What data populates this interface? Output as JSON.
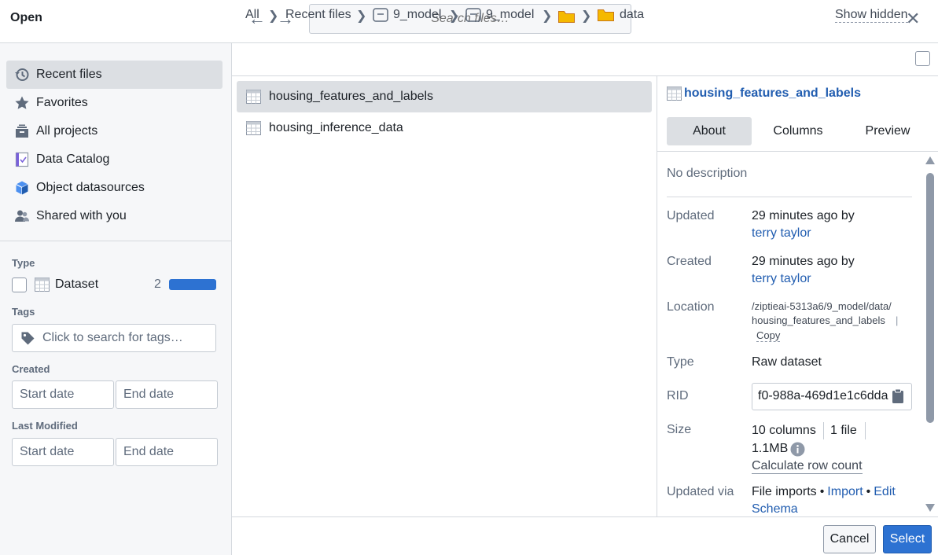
{
  "window": {
    "title": "Open"
  },
  "search": {
    "placeholder": "Search files…"
  },
  "sidebar": {
    "items": [
      {
        "label": "Recent files",
        "icon": "history-icon"
      },
      {
        "label": "Favorites",
        "icon": "star-icon"
      },
      {
        "label": "All projects",
        "icon": "projects-icon"
      },
      {
        "label": "Data Catalog",
        "icon": "catalog-icon"
      },
      {
        "label": "Object datasources",
        "icon": "cube-icon"
      },
      {
        "label": "Shared with you",
        "icon": "people-icon"
      }
    ],
    "type_label": "Type",
    "type_option": {
      "label": "Dataset",
      "count": "2",
      "bar_fraction": 1.0
    },
    "tags_label": "Tags",
    "tags_placeholder": "Click to search for tags…",
    "created_label": "Created",
    "last_modified_label": "Last Modified",
    "start_placeholder": "Start date",
    "end_placeholder": "End date"
  },
  "breadcrumb": {
    "items": [
      "All",
      "Recent files",
      "9_model",
      "9_model",
      "",
      "data"
    ],
    "show_hidden": "Show hidden"
  },
  "files": [
    {
      "name": "housing_features_and_labels",
      "selected": true
    },
    {
      "name": "housing_inference_data",
      "selected": false
    }
  ],
  "details": {
    "title": "housing_features_and_labels",
    "tabs": [
      "About",
      "Columns",
      "Preview"
    ],
    "description": "No description",
    "updated_label": "Updated",
    "updated_value": "29 minutes ago by",
    "updated_by": "terry taylor",
    "created_label": "Created",
    "created_value": "29 minutes ago by",
    "created_by": "terry taylor",
    "location_label": "Location",
    "location_line1": "/ziptieai-5313a6/9_model/data/",
    "location_line2": "housing_features_and_labels",
    "location_sep": "|",
    "copy": "Copy",
    "type_label": "Type",
    "type_value": "Raw dataset",
    "rid_label": "RID",
    "rid_value": "f0-988a-469d1e1c6dda",
    "size_label": "Size",
    "size_columns": "10 columns",
    "size_files": "1 file",
    "size_bytes": "1.1MB",
    "calc_rows": "Calculate row count",
    "updated_via_label": "Updated via",
    "updated_via_text": "File imports",
    "bullet": "•",
    "import_link": "Import",
    "edit_link": "Edit",
    "schema_link": "Schema"
  },
  "footer": {
    "cancel": "Cancel",
    "select": "Select"
  },
  "colors": {
    "accent": "#2d72d2",
    "link": "#215db0",
    "folder": "#f5b900"
  }
}
